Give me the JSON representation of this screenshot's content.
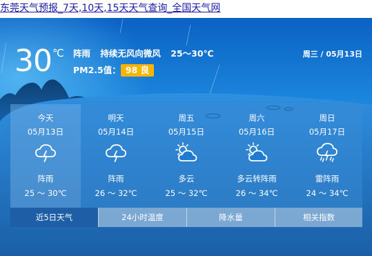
{
  "page": {
    "link_text": "东莞天气预报_7天,10天,15天天气查询_全国天气网"
  },
  "current": {
    "temperature": "30",
    "unit": "℃",
    "condition": "阵雨",
    "wind": "持续无风向微风",
    "temp_range": "25～30℃",
    "pm_label": "PM2.5值：",
    "aqi_value": "98 良",
    "date": "周三 / 05月13日"
  },
  "colors": {
    "aqi_badge": "#f7b500",
    "panel_top": "#0b62c4",
    "panel_bottom": "#14599f",
    "active_tab": "#1d5ea7"
  },
  "forecast": [
    {
      "day": "今天",
      "date": "05月13日",
      "icon": "thunderstorm-icon",
      "condition": "阵雨",
      "temp": "25 ～ 30℃"
    },
    {
      "day": "明天",
      "date": "05月14日",
      "icon": "thunderstorm-icon",
      "condition": "阵雨",
      "temp": "26 ～ 32℃"
    },
    {
      "day": "周五",
      "date": "05月15日",
      "icon": "partly-cloudy-icon",
      "condition": "多云",
      "temp": "25 ～ 32℃"
    },
    {
      "day": "周六",
      "date": "05月16日",
      "icon": "partly-cloudy-icon",
      "condition": "多云转阵雨",
      "temp": "26 ～ 34℃"
    },
    {
      "day": "周日",
      "date": "05月17日",
      "icon": "thunder-shower-icon",
      "condition": "雷阵雨",
      "temp": "24 ～ 34℃"
    }
  ],
  "tabs": [
    {
      "label": "近5日天气"
    },
    {
      "label": "24小时温度"
    },
    {
      "label": "降水量"
    },
    {
      "label": "相关指数"
    }
  ]
}
